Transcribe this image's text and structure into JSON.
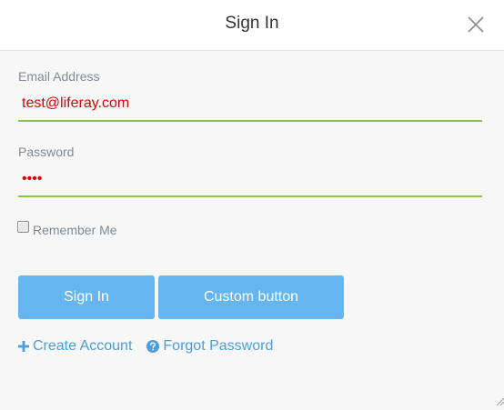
{
  "dialog": {
    "title": "Sign In"
  },
  "form": {
    "email": {
      "label": "Email Address",
      "value": "test@liferay.com"
    },
    "password": {
      "label": "Password",
      "value": "test"
    },
    "remember_me": {
      "label": "Remember Me",
      "checked": false
    }
  },
  "buttons": {
    "sign_in": "Sign In",
    "custom": "Custom button"
  },
  "links": {
    "create_account": "Create Account",
    "forgot_password": "Forgot Password"
  },
  "colors": {
    "accent_button": "#65b6f0",
    "link": "#4aa0dc",
    "input_underline": "#8bc34a",
    "input_text": "#e00000"
  },
  "icons": {
    "close": "close-icon",
    "create_account": "plus-icon",
    "forgot_password": "question-circle-icon"
  }
}
